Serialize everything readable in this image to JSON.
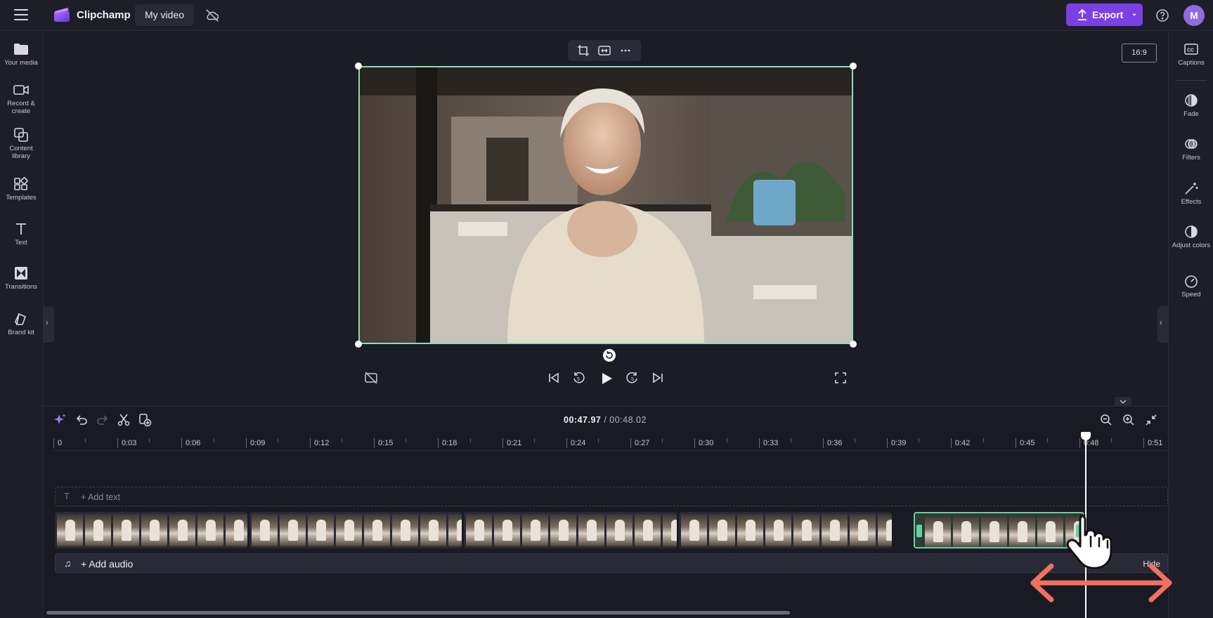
{
  "app": {
    "brand": "Clipchamp",
    "project_name": "My video",
    "export_label": "Export",
    "avatar_initial": "M",
    "accent": "#7b3fe4",
    "selection_color": "#5fd3a0"
  },
  "left_sidebar": {
    "items": [
      {
        "label": "Your media",
        "icon": "folder-icon"
      },
      {
        "label": "Record & create",
        "icon": "camera-icon"
      },
      {
        "label": "Content library",
        "icon": "library-icon"
      },
      {
        "label": "Templates",
        "icon": "grid-icon"
      },
      {
        "label": "Text",
        "icon": "text-icon"
      },
      {
        "label": "Transitions",
        "icon": "transition-icon"
      },
      {
        "label": "Brand kit",
        "icon": "brand-icon"
      }
    ]
  },
  "right_sidebar": {
    "items": [
      {
        "label": "Captions",
        "icon": "cc-icon"
      },
      {
        "label": "Fade",
        "icon": "fade-icon"
      },
      {
        "label": "Filters",
        "icon": "filters-icon"
      },
      {
        "label": "Effects",
        "icon": "magic-wand-icon"
      },
      {
        "label": "Adjust colors",
        "icon": "contrast-icon"
      },
      {
        "label": "Speed",
        "icon": "speedometer-icon"
      }
    ]
  },
  "preview": {
    "aspect_ratio": "16:9"
  },
  "timeline": {
    "current_time": "00:47.97",
    "total_time": "/ 00:48.02",
    "ruler_ticks": [
      "0",
      "0:03",
      "0:06",
      "0:09",
      "0:12",
      "0:15",
      "0:18",
      "0:21",
      "0:24",
      "0:27",
      "0:30",
      "0:33",
      "0:36",
      "0:39",
      "0:42",
      "0:45",
      "0:48",
      "0:51"
    ],
    "add_text": "+ Add text",
    "add_audio": "+ Add audio",
    "hide_label": "Hide"
  }
}
